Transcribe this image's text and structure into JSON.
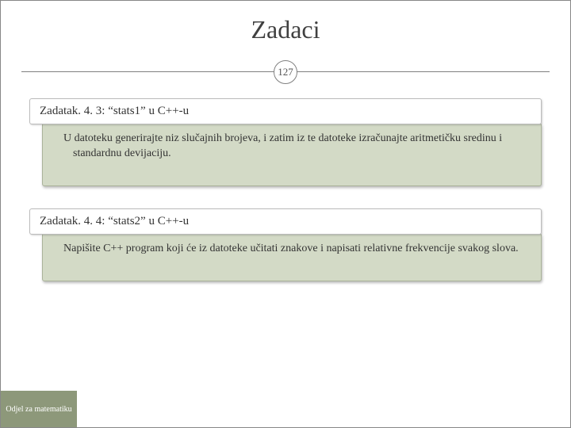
{
  "title": "Zadaci",
  "page_number": "127",
  "tasks": [
    {
      "heading": "Zadatak. 4. 3: “stats1” u C++-u",
      "body": "U datoteku generirajte niz slučajnih brojeva, i zatim iz te datoteke izračunajte aritmetičku sredinu i standardnu devijaciju."
    },
    {
      "heading": "Zadatak. 4. 4: “stats2” u C++-u",
      "body": "Napišite C++ program koji će iz datoteke učitati znakove i napisati relativne frekvencije svakog slova."
    }
  ],
  "footer": "Odjel za matematiku"
}
